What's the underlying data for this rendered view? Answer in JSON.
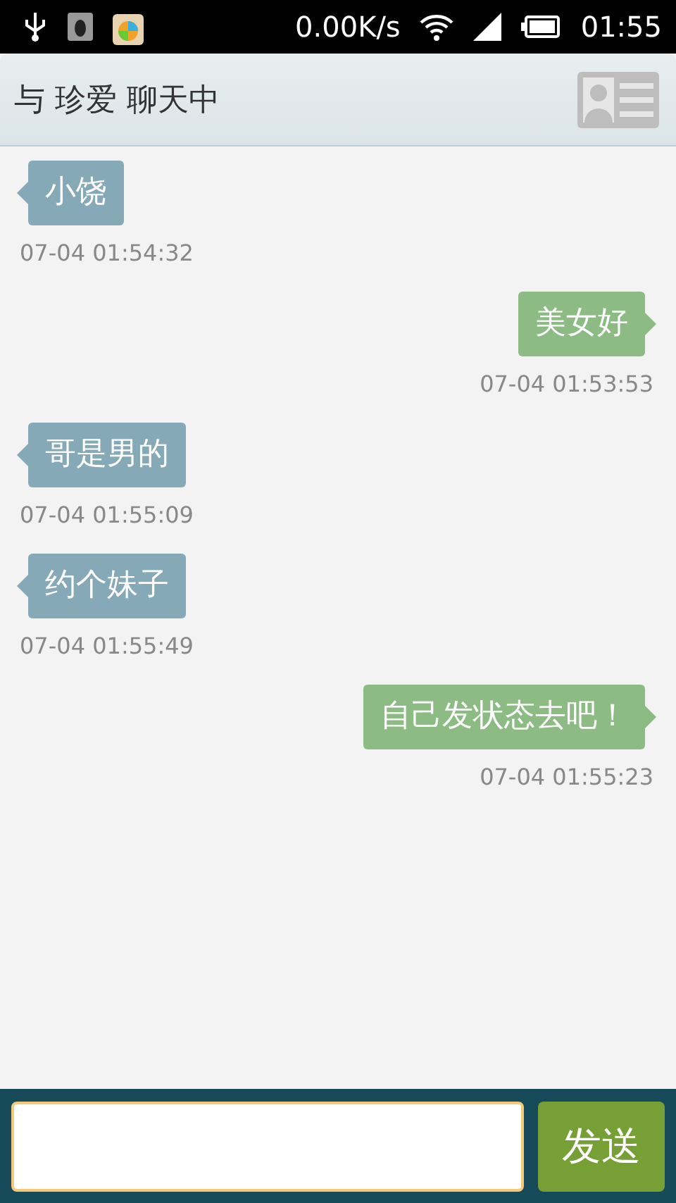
{
  "status_bar": {
    "speed": "0.00K/s",
    "time": "01:55"
  },
  "header": {
    "title": "与 珍爱 聊天中"
  },
  "messages": [
    {
      "kind": "received",
      "text": "小饶",
      "time": "07-04 01:54:32"
    },
    {
      "kind": "sent",
      "text": "美女好",
      "time": "07-04 01:53:53"
    },
    {
      "kind": "received",
      "text": "哥是男的",
      "time": "07-04 01:55:09"
    },
    {
      "kind": "received",
      "text": "约个妹子",
      "time": "07-04 01:55:49"
    },
    {
      "kind": "sent",
      "text": "自己发状态去吧！",
      "time": "07-04 01:55:23"
    }
  ],
  "composer": {
    "send": "发送"
  }
}
